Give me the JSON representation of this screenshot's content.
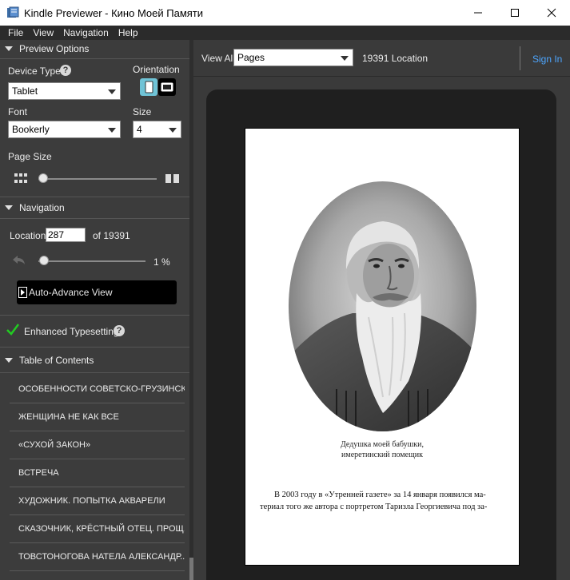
{
  "window": {
    "title": "Kindle Previewer - Кино Моей Памяти"
  },
  "menu": [
    "File",
    "View",
    "Navigation",
    "Help"
  ],
  "preview_options": {
    "header": "Preview Options",
    "device_type_label": "Device Type",
    "device_type_value": "Tablet",
    "orientation_label": "Orientation",
    "font_label": "Font",
    "font_value": "Bookerly",
    "size_label": "Size",
    "size_value": "4",
    "page_size_label": "Page Size"
  },
  "navigation": {
    "header": "Navigation",
    "location_label": "Location",
    "location_value": "287",
    "location_of": "of 19391",
    "progress_percent": "1 %",
    "progress_fraction": 0.01,
    "auto_advance_label": "Auto-Advance View"
  },
  "enhanced_typesetting_label": "Enhanced Typesetting",
  "toc": {
    "header": "Table of Contents",
    "items": [
      "ОСОБЕННОСТИ СОВЕТСКО-ГРУЗИНСК...",
      "ЖЕНЩИНА НЕ КАК ВСЕ",
      "«СУХОЙ ЗАКОН»",
      "ВСТРЕЧА",
      "ХУДОЖНИК. ПОПЫТКА АКВАРЕЛИ",
      "СКАЗОЧНИК, КРЁСТНЫЙ ОТЕЦ. ПРОЩ...",
      "ТОВСТОНОГОВА НАТЕЛА АЛЕКСАНДР..."
    ]
  },
  "toolbar": {
    "view_all_label": "View All",
    "view_mode_value": "Pages",
    "location_count": "19391 Location",
    "sign_in_label": "Sign In"
  },
  "page": {
    "caption_line1": "Дедушка моей бабушки,",
    "caption_line2": "имеретинский помещик",
    "text_line1": "В 2003 году в «Утренней газете» за 14 января появился ма-",
    "text_line2": "териал того же автора с портретом Таризла Георгиевича под за-"
  },
  "colors": {
    "accent": "#4da6ff",
    "check": "#22cc22",
    "panel": "#3c3c3c"
  }
}
